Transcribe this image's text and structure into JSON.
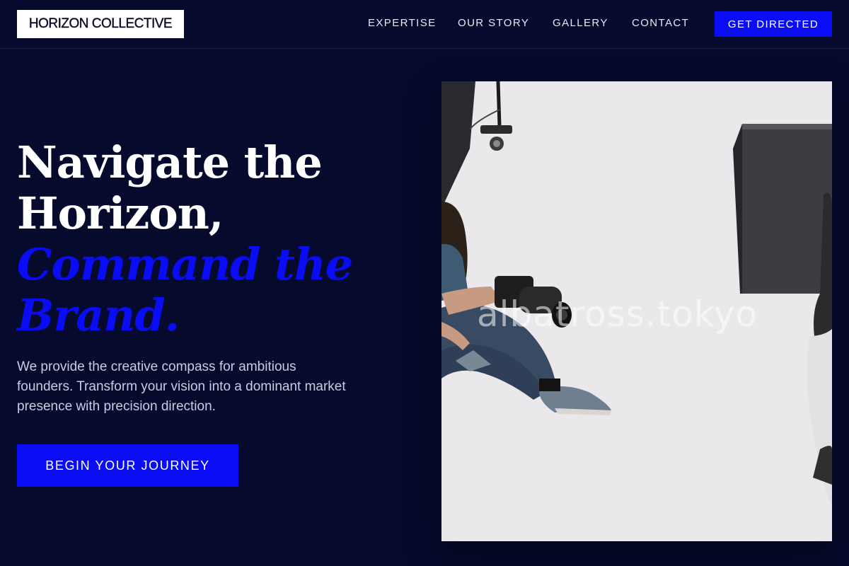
{
  "header": {
    "logo": "HORIZON COLLECTIVE",
    "nav": [
      {
        "label": "EXPERTISE"
      },
      {
        "label": "OUR STORY"
      },
      {
        "label": "GALLERY"
      },
      {
        "label": "CONTACT"
      }
    ],
    "cta_label": "GET DIRECTED"
  },
  "hero": {
    "headline_line1": "Navigate the",
    "headline_line2": "Horizon,",
    "headline_accent_line1": "Command the",
    "headline_accent_line2": "Brand.",
    "subtext": "We provide the creative compass for ambitious founders. Transform your vision into a dominant market presence with precision direction.",
    "cta_label": "BEGIN YOUR JOURNEY",
    "image_watermark": "albatross.tokyo"
  },
  "colors": {
    "background": "#060b2e",
    "accent": "#0a0cf5",
    "text": "#ffffff",
    "muted_text": "#c9cce0"
  }
}
